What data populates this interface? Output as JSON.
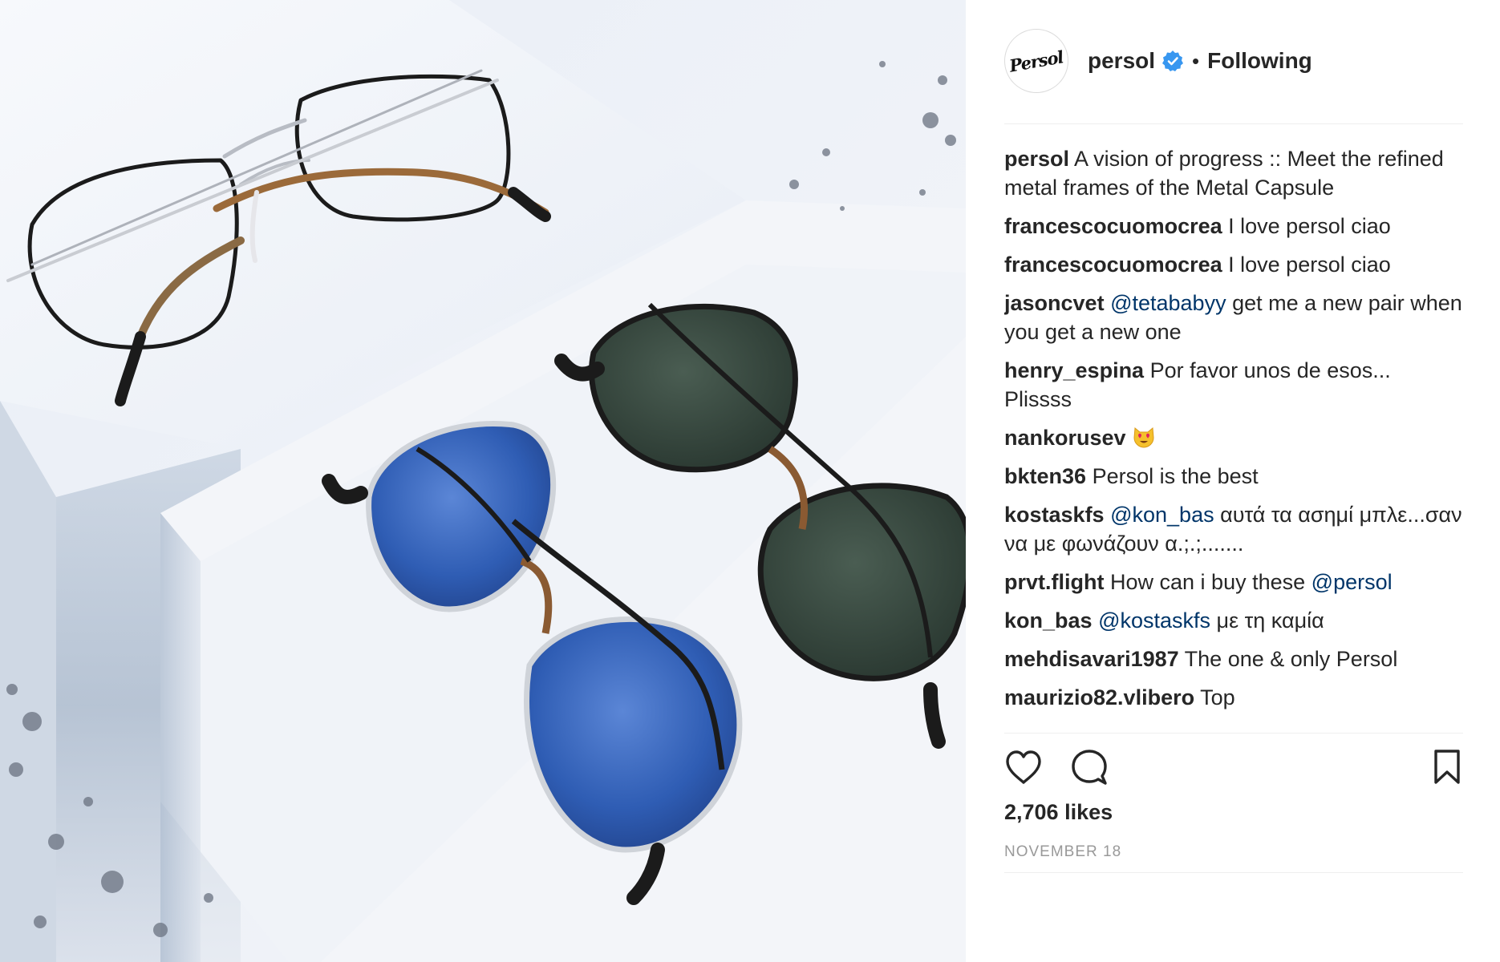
{
  "post": {
    "username": "persol",
    "verified": true,
    "separator": "•",
    "follow_status": "Following",
    "avatar_logo_text": "Persol",
    "likes": "2,706 likes",
    "date": "NOVEMBER 18"
  },
  "comments": [
    {
      "user": "persol",
      "parts": [
        {
          "type": "text",
          "value": "A vision of progress :: Meet the refined metal frames of the Metal Capsule"
        }
      ]
    },
    {
      "user": "francescocuomocrea",
      "parts": [
        {
          "type": "text",
          "value": "I love persol ciao"
        }
      ]
    },
    {
      "user": "francescocuomocrea",
      "parts": [
        {
          "type": "text",
          "value": "I love persol ciao"
        }
      ]
    },
    {
      "user": "jasoncvet",
      "parts": [
        {
          "type": "mention",
          "value": "@tetababyy"
        },
        {
          "type": "text",
          "value": "get me a new pair when you get a new one"
        }
      ]
    },
    {
      "user": "henry_espina",
      "parts": [
        {
          "type": "text",
          "value": "Por favor unos de esos... Plissss"
        }
      ]
    },
    {
      "user": "nankorusev",
      "parts": [
        {
          "type": "emoji",
          "value": "heart-eyes-cat-emoji"
        }
      ]
    },
    {
      "user": "bkten36",
      "parts": [
        {
          "type": "text",
          "value": "Persol is the best"
        }
      ]
    },
    {
      "user": "kostaskfs",
      "parts": [
        {
          "type": "mention",
          "value": "@kon_bas"
        },
        {
          "type": "text",
          "value": "αυτά τα ασημί μπλε...σαν να με φωνάζουν α.;.;......."
        }
      ]
    },
    {
      "user": "prvt.flight",
      "parts": [
        {
          "type": "text",
          "value": "How can i buy these"
        },
        {
          "type": "mention",
          "value": "@persol"
        }
      ]
    },
    {
      "user": "kon_bas",
      "parts": [
        {
          "type": "mention",
          "value": "@kostaskfs"
        },
        {
          "type": "text",
          "value": "με τη καμία"
        }
      ]
    },
    {
      "user": "mehdisavari1987",
      "parts": [
        {
          "type": "text",
          "value": "The one & only Persol"
        }
      ]
    },
    {
      "user": "maurizio82.vlibero",
      "parts": [
        {
          "type": "text",
          "value": "Top"
        }
      ]
    }
  ],
  "icons": {
    "like": "heart-outline-icon",
    "comment": "speech-bubble-icon",
    "save": "bookmark-icon",
    "verified": "verified-badge-icon"
  },
  "colors": {
    "text": "#262626",
    "mention": "#003569",
    "muted": "#999999",
    "verified_blue": "#3897f0",
    "divider": "#efefef"
  }
}
